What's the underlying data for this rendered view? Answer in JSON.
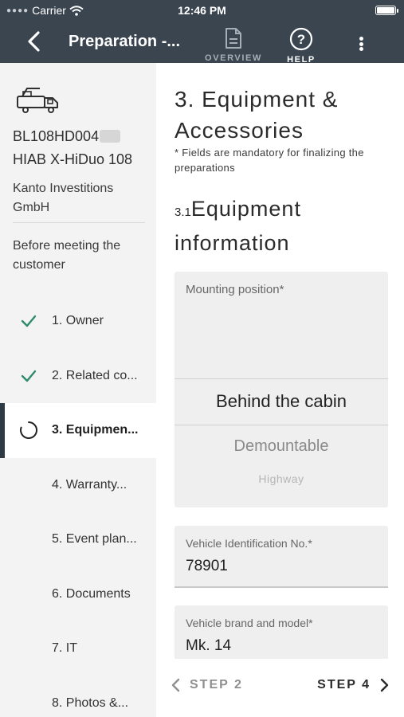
{
  "status_bar": {
    "carrier": "Carrier",
    "time": "12:46 PM"
  },
  "nav": {
    "title": "Preparation  -...",
    "overview_label": "OVERVIEW",
    "help_label": "HELP"
  },
  "sidebar": {
    "serial": "BL108HD004",
    "model": "HIAB X-HiDuo 108",
    "company": "Kanto Investitions GmbH",
    "phase": "Before meeting the customer",
    "steps": [
      {
        "label": "1. Owner",
        "status": "done"
      },
      {
        "label": "2. Related co...",
        "status": "done"
      },
      {
        "label": "3. Equipmen...",
        "status": "in-progress"
      },
      {
        "label": "4. Warranty...",
        "status": "todo"
      },
      {
        "label": "5. Event plan...",
        "status": "todo"
      },
      {
        "label": "6. Documents",
        "status": "todo"
      },
      {
        "label": "7. IT",
        "status": "todo"
      },
      {
        "label": "8. Photos &...",
        "status": "todo"
      }
    ]
  },
  "main": {
    "section_title": "3. Equipment & Accessories",
    "note": "* Fields are mandatory for finalizing the preparations",
    "subsection_number": "3.1",
    "subsection_title": "Equipment information",
    "mounting": {
      "label": "Mounting position*",
      "selected": "Behind the cabin",
      "next_options": [
        "Demountable",
        "Highway"
      ]
    },
    "vin": {
      "label": "Vehicle Identification No.*",
      "value": "78901"
    },
    "brand": {
      "label": "Vehicle brand and model*",
      "value": "Mk. 14"
    }
  },
  "bottom_nav": {
    "prev_label": "STEP 2",
    "next_label": "STEP 4"
  },
  "colors": {
    "topbar": "#3a4550",
    "sidebar_bg": "#f3f3f3",
    "check_green": "#2e8b6a",
    "active_marker": "#2e3a44"
  }
}
